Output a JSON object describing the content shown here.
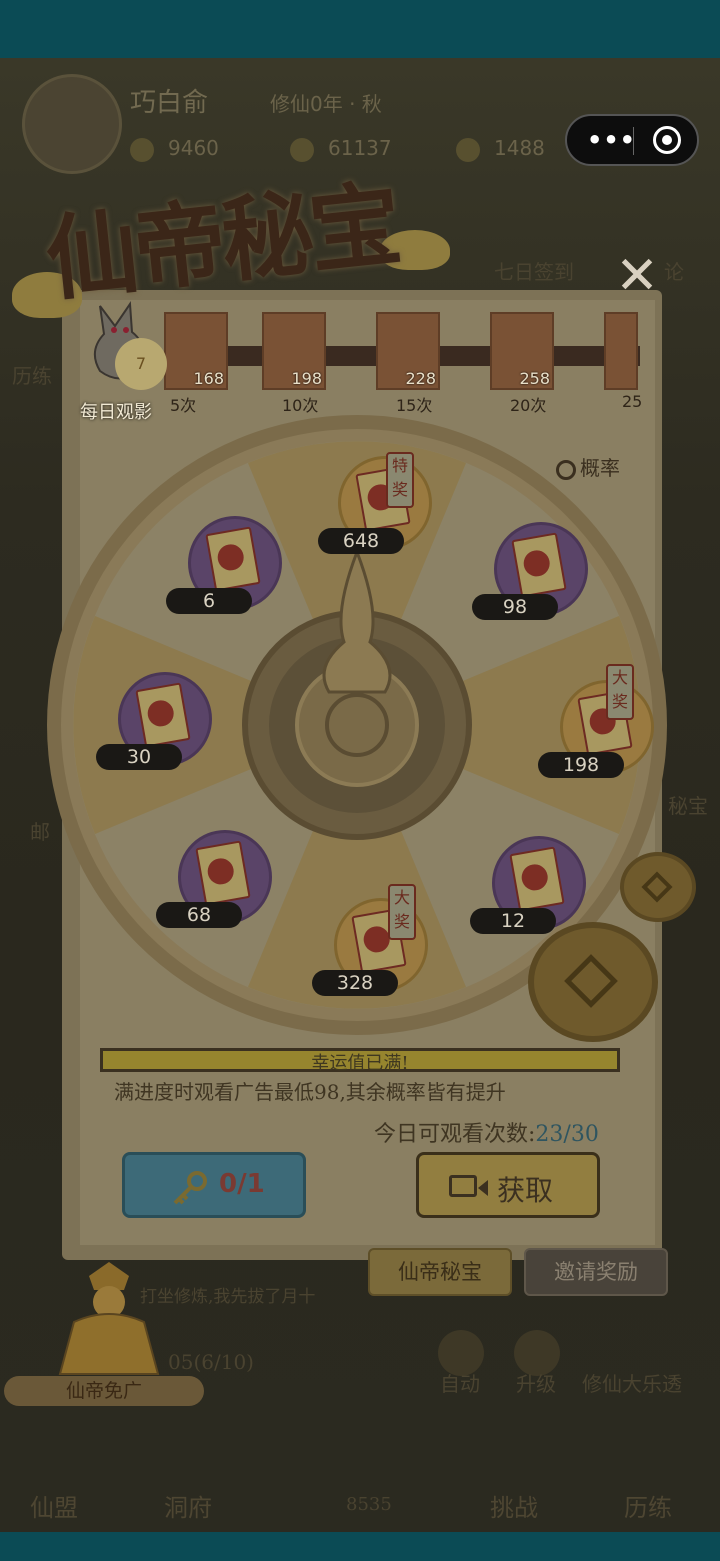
{
  "player": {
    "name": "巧白俞",
    "info": "修仙0年 · 秋"
  },
  "resources": [
    {
      "icon": "spirit-stone-icon",
      "value": "9460"
    },
    {
      "icon": "water-drop-icon",
      "value": "61137"
    },
    {
      "icon": "pouch-icon",
      "value": "1488"
    }
  ],
  "capsule": {
    "more": "•••"
  },
  "popup": {
    "title": "仙帝秘宝",
    "close": "✕",
    "daily_label": "每日观影",
    "daily_count": "7",
    "probability": "概率",
    "milestones": [
      {
        "value": "168",
        "label": "5次"
      },
      {
        "value": "198",
        "label": "10次"
      },
      {
        "value": "228",
        "label": "15次"
      },
      {
        "value": "258",
        "label": "20次"
      },
      {
        "value": "",
        "label": "25"
      }
    ],
    "prizes": [
      {
        "amount": "648",
        "tag": "特奖"
      },
      {
        "amount": "98",
        "tag": ""
      },
      {
        "amount": "198",
        "tag": "大奖"
      },
      {
        "amount": "12",
        "tag": ""
      },
      {
        "amount": "328",
        "tag": "大奖"
      },
      {
        "amount": "68",
        "tag": ""
      },
      {
        "amount": "30",
        "tag": ""
      },
      {
        "amount": "6",
        "tag": ""
      }
    ],
    "luck_text": "幸运值已满!",
    "luck_note": "满进度时观看广告最低98,其余概率皆有提升",
    "watch_label": "今日可观看次数:",
    "watch_count": "23/30",
    "key_count": "0/1",
    "get_label": "获取"
  },
  "bottom_pills": {
    "treasure": "仙帝秘宝",
    "invite": "邀请奖励"
  },
  "deity_label": "仙帝免广",
  "background": {
    "side_left": "历练",
    "side_left2": "邮",
    "side_right": "秘宝",
    "top_right": "论",
    "event": "七日签到",
    "chat": "打坐修炼,我先拔了月十",
    "task": "05(6/10)",
    "auto": "自动",
    "upgrade": "升级",
    "big_event": "修仙大乐透",
    "center_value": "8535",
    "nav": [
      "仙盟",
      "洞府",
      "挑战",
      "历练"
    ]
  },
  "colors": {
    "accent_teal": "#0b4b55",
    "luck_bar": "#96852e",
    "key_button": "#3d6a78",
    "get_button": "#927e40"
  }
}
